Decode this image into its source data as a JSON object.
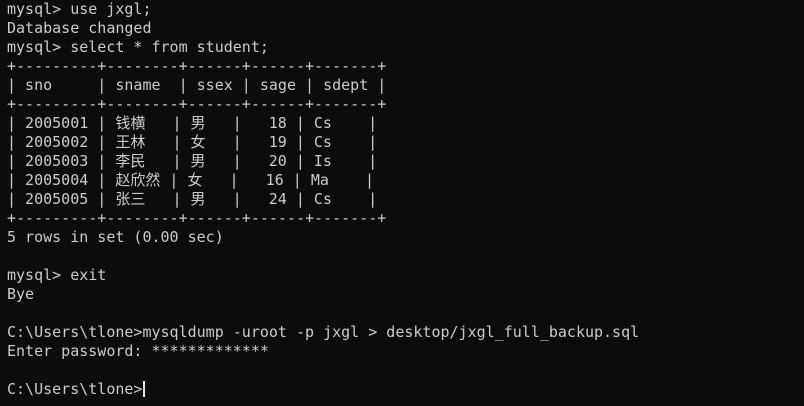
{
  "terminal": {
    "lines": [
      "mysql> use jxgl;",
      "Database changed",
      "mysql> select * from student;",
      "+---------+--------+------+------+-------+",
      "| sno     | sname  | ssex | sage | sdept |",
      "+---------+--------+------+------+-------+",
      "| 2005001 | 钱横   | 男   |   18 | Cs    |",
      "| 2005002 | 王林   | 女   |   19 | Cs    |",
      "| 2005003 | 李民   | 男   |   20 | Is    |",
      "| 2005004 | 赵欣然 | 女   |   16 | Ma    |",
      "| 2005005 | 张三   | 男   |   24 | Cs    |",
      "+---------+--------+------+------+-------+",
      "5 rows in set (0.00 sec)",
      "",
      "mysql> exit",
      "Bye",
      "",
      "C:\\Users\\tlone>mysqldump -uroot -p jxgl > desktop/jxgl_full_backup.sql",
      "Enter password: *************",
      "",
      "C:\\Users\\tlone>"
    ],
    "colors": {
      "background": "#0c0c0c",
      "foreground": "#cccccc",
      "cursor": "#e6e6e6"
    }
  }
}
